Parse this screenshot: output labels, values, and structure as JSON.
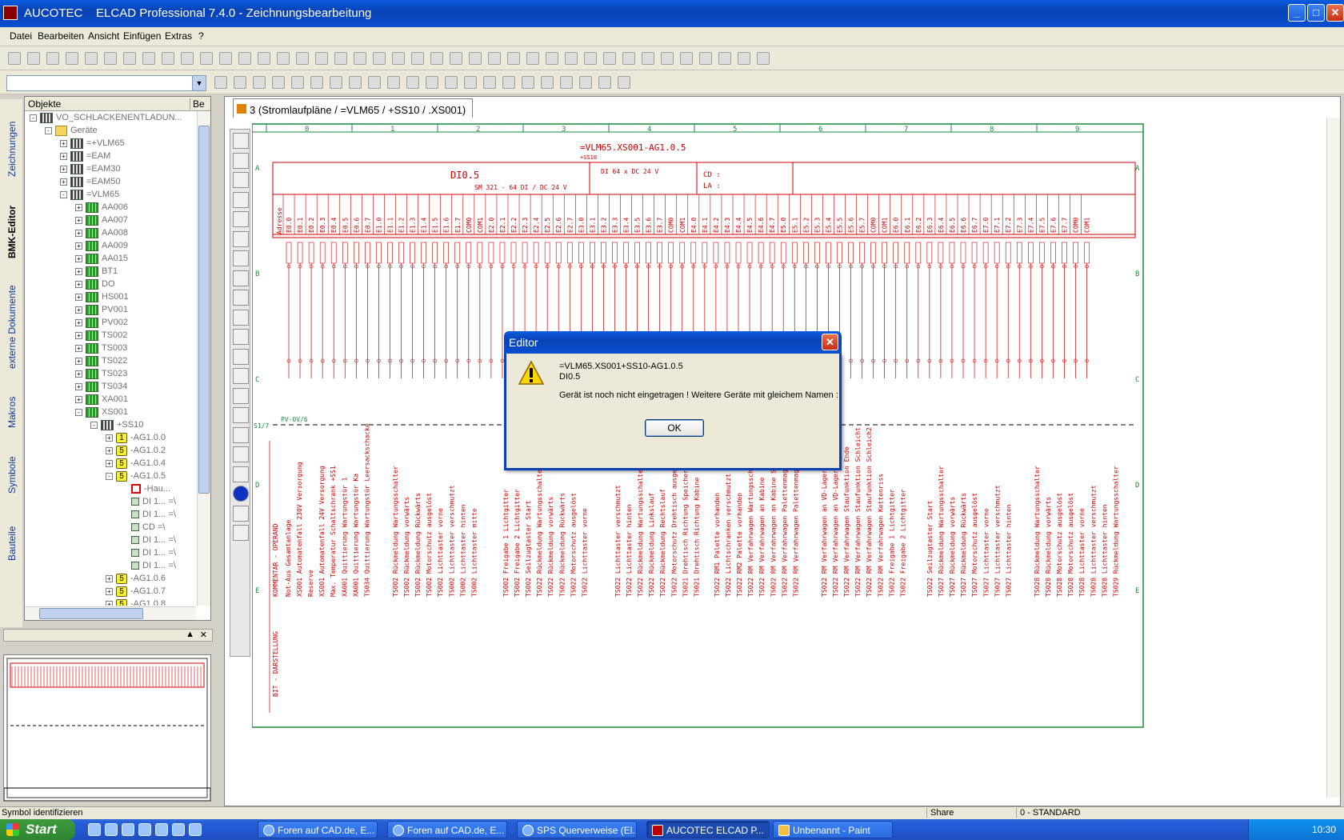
{
  "window": {
    "app": "AUCOTEC",
    "title": "ELCAD Professional 7.4.0 - Zeichnungsbearbeitung"
  },
  "menu": [
    "Datei",
    "Bearbeiten",
    "Ansicht",
    "Einfügen",
    "Extras",
    "?"
  ],
  "side_tabs": [
    "Zeichnungen",
    "BMK-Editor",
    "externe Dokumente",
    "Makros",
    "Symbole",
    "Bauteile"
  ],
  "objects": {
    "header": "Objekte",
    "header2": "Be",
    "tree": [
      {
        "label": "VO_SCHLACKENENTLADUN...",
        "indent": 0,
        "exp": "-",
        "icon": "dark"
      },
      {
        "label": "Geräte",
        "indent": 1,
        "exp": "-",
        "icon": "fold"
      },
      {
        "label": "=+VLM65",
        "indent": 2,
        "exp": "+",
        "icon": "dark"
      },
      {
        "label": "=EAM",
        "indent": 2,
        "exp": "+",
        "icon": "dark"
      },
      {
        "label": "=EAM30",
        "indent": 2,
        "exp": "+",
        "icon": "dark"
      },
      {
        "label": "=EAM50",
        "indent": 2,
        "exp": "+",
        "icon": "dark"
      },
      {
        "label": "=VLM65",
        "indent": 2,
        "exp": "-",
        "icon": "dark"
      },
      {
        "label": "AA006",
        "indent": 3,
        "exp": "+",
        "icon": "green"
      },
      {
        "label": "AA007",
        "indent": 3,
        "exp": "+",
        "icon": "green"
      },
      {
        "label": "AA008",
        "indent": 3,
        "exp": "+",
        "icon": "green"
      },
      {
        "label": "AA009",
        "indent": 3,
        "exp": "+",
        "icon": "green"
      },
      {
        "label": "AA015",
        "indent": 3,
        "exp": "+",
        "icon": "green"
      },
      {
        "label": "BT1",
        "indent": 3,
        "exp": "+",
        "icon": "green"
      },
      {
        "label": "DO",
        "indent": 3,
        "exp": "+",
        "icon": "green"
      },
      {
        "label": "HS001",
        "indent": 3,
        "exp": "+",
        "icon": "green"
      },
      {
        "label": "PV001",
        "indent": 3,
        "exp": "+",
        "icon": "green"
      },
      {
        "label": "PV002",
        "indent": 3,
        "exp": "+",
        "icon": "green"
      },
      {
        "label": "TS002",
        "indent": 3,
        "exp": "+",
        "icon": "green"
      },
      {
        "label": "TS003",
        "indent": 3,
        "exp": "+",
        "icon": "green"
      },
      {
        "label": "TS022",
        "indent": 3,
        "exp": "+",
        "icon": "green"
      },
      {
        "label": "TS023",
        "indent": 3,
        "exp": "+",
        "icon": "green"
      },
      {
        "label": "TS034",
        "indent": 3,
        "exp": "+",
        "icon": "green"
      },
      {
        "label": "XA001",
        "indent": 3,
        "exp": "+",
        "icon": "green"
      },
      {
        "label": "XS001",
        "indent": 3,
        "exp": "-",
        "icon": "green"
      },
      {
        "label": "+SS10",
        "indent": 4,
        "exp": "-",
        "icon": "dark"
      },
      {
        "label": "-AG1.0.0",
        "indent": 5,
        "exp": "+",
        "icon": "yel",
        "num": "1"
      },
      {
        "label": "-AG1.0.2",
        "indent": 5,
        "exp": "+",
        "icon": "yel",
        "num": "5"
      },
      {
        "label": "-AG1.0.4",
        "indent": 5,
        "exp": "+",
        "icon": "yel",
        "num": "5"
      },
      {
        "label": "-AG1.0.5",
        "indent": 5,
        "exp": "-",
        "icon": "yel",
        "num": "5"
      },
      {
        "label": "-Hau...",
        "indent": 6,
        "exp": "",
        "icon": "red"
      },
      {
        "label": "DI 1...  =\\",
        "indent": 6,
        "exp": "",
        "icon": "small"
      },
      {
        "label": "DI 1...  =\\",
        "indent": 6,
        "exp": "",
        "icon": "small"
      },
      {
        "label": "CD      =\\",
        "indent": 6,
        "exp": "",
        "icon": "small"
      },
      {
        "label": "DI 1...  =\\",
        "indent": 6,
        "exp": "",
        "icon": "small"
      },
      {
        "label": "DI 1...  =\\",
        "indent": 6,
        "exp": "",
        "icon": "small"
      },
      {
        "label": "DI 1...  =\\",
        "indent": 6,
        "exp": "",
        "icon": "small"
      },
      {
        "label": "-AG1.0.6",
        "indent": 5,
        "exp": "+",
        "icon": "yel",
        "num": "5"
      },
      {
        "label": "-AG1.0.7",
        "indent": 5,
        "exp": "+",
        "icon": "yel",
        "num": "5"
      },
      {
        "label": "-AG1.0.8",
        "indent": 5,
        "exp": "+",
        "icon": "yel",
        "num": "5"
      }
    ]
  },
  "document_tab": "3 (Stromlaufpläne / =VLM65 / +SS10 / .XS001)",
  "sheet": {
    "columns": [
      "0",
      "1",
      "2",
      "3",
      "4",
      "5",
      "6",
      "7",
      "8",
      "9"
    ],
    "rows": [
      "A",
      "B",
      "C",
      "D",
      "E"
    ],
    "header": "=VLM65.XS001-AG1.0.5",
    "subheader": "+SS10",
    "module1": "DI0.5",
    "module1_desc": "SM 321 - 64 DI / DC 24 V",
    "module2": "DI 64 x DC 24 V",
    "cd": "CD :",
    "la": "LA :",
    "adresse": "Adresse",
    "pv_label": "PV-0V/6",
    "s_label": "S1/7",
    "kommentar": "KOMMENTAR - OPERAND",
    "bit": "BIT - DARSTELLUNG",
    "addresses": [
      "E0.0",
      "E0.1",
      "E0.2",
      "E0.3",
      "E0.4",
      "E0.5",
      "E0.6",
      "E0.7",
      "E1.0",
      "E1.1",
      "E1.2",
      "E1.3",
      "E1.4",
      "E1.5",
      "E1.6",
      "E1.7",
      "COM0",
      "COM1",
      "E2.0",
      "E2.1",
      "E2.2",
      "E2.3",
      "E2.4",
      "E2.5",
      "E2.6",
      "E2.7",
      "E3.0",
      "E3.1",
      "E3.2",
      "E3.3",
      "E3.4",
      "E3.5",
      "E3.6",
      "E3.7",
      "COM0",
      "COM1",
      "E4.0",
      "E4.1",
      "E4.2",
      "E4.3",
      "E4.4",
      "E4.5",
      "E4.6",
      "E4.7",
      "E5.0",
      "E5.1",
      "E5.2",
      "E5.3",
      "E5.4",
      "E5.5",
      "E5.6",
      "E5.7",
      "COM0",
      "COM1",
      "E6.0",
      "E6.1",
      "E6.2",
      "E6.3",
      "E6.4",
      "E6.5",
      "E6.6",
      "E6.7",
      "E7.0",
      "E7.1",
      "E7.2",
      "E7.3",
      "E7.4",
      "E7.5",
      "E7.6",
      "E7.7",
      "COM0",
      "COM1"
    ],
    "comments_a": [
      "Not-Aus Gesamtanlage",
      "XS001 Automatenfall 230V Versorgung",
      "Reserve",
      "XS001 Automatenfall 24V Versorgung",
      "Max. Temperatur Schaltschrank +SS1",
      "XA001 Quittierung Wartungstür 1",
      "XA001 Quittierung Wartungstür Ka",
      "TS034 Quittierung Wartungstür Leersackschacke"
    ],
    "comments_b": [
      "TS002 Rückmeldung Wartungsschalter",
      "TS002 Rückmeldung vorwärts",
      "TS002 Rückmeldung Rückwärts",
      "TS002 Motorschutz ausgelöst",
      "TS002 Lichttaster vorne",
      "TS002 Lichttaster verschmutzt",
      "TS002 Lichttaster hinten",
      "TS002 Lichttaster mitte"
    ],
    "comments_c": [
      "TS002 Freigabe 1 Lichtgitter",
      "TS002 Freigabe 2 Lichtgitter",
      "TS002 Seilzugtaster Start",
      "TS022 Rückmeldung Wartungsschalter",
      "TS022 Rückmeldung vorwärts",
      "TS022 Rückmeldung Rückwärts",
      "TS022 Motorschutz ausgelöst",
      "TS022 Lichttaster vorne"
    ],
    "comments_d": [
      "TS022 Lichttaster verschmutzt",
      "TS022 Lichttaster hinten",
      "TS022 Rückmeldung Wartungsschalter Drel",
      "TS022 Rückmeldung Linkslauf",
      "TS022 Rückmeldung Rechtslauf",
      "TS022 Motorschutz Drehtisch ausgelöst",
      "TS021 Drehtisch Richtung Speicher",
      "TS021 Drehtisch Richtung Kabine"
    ],
    "comments_e": [
      "TS022 RM1 Palette vorhanden",
      "TS022 Lichtschranken verschmutzt",
      "TS022 RM2 Palette vorhanden",
      "TS022 RM Verfahrwagen Wartungsschalter Ver",
      "TS022 RM Verfahrwagen an Kabine",
      "TS022 RM Verfahrwagen an Kabine Schleic",
      "TS022 RM Verfahrwagen Palettenmag. Ende",
      "TS022 RM Verfahrwagen Palettenmag. Schlei"
    ],
    "comments_f": [
      "TS022 RM Verfahrwagen an VD-Lager Ende",
      "TS022 RM Verfahrwagen an VD-Lager Schleich",
      "TS022 RM Verfahrwagen Staufunktion Ende",
      "TS022 RM Verfahrwagen Staufunktion Schleicht",
      "TS022 RM Verfahrwagen Staufunktion Schleich2",
      "TS022 RM Verfahrwagen Kettenriss",
      "TS022 Freigabe 1 Lichtgitter",
      "TS022 Freigabe 2 Lichtgitter"
    ],
    "comments_g": [
      "TS022 Seilzugtaster Start",
      "TS027 Rückmeldung Wartungsschalter",
      "TS027 Rückmeldung vorwärts",
      "TS027 Rückmeldung Rückwärts",
      "TS027 Motorschutz ausgelöst",
      "TS027 Lichttaster vorne",
      "TS027 Lichttaster verschmutzt",
      "TS027 Lichttaster hinten"
    ],
    "comments_h": [
      "TS028 Rückmeldung Wartungsschalter",
      "TS028 Rückmeldung vorwärts",
      "TS028 Motorschutz ausgelöst",
      "TS028 Motorschutz ausgelöst",
      "TS028 Lichttaster vorne",
      "TS028 Lichttaster verschmutzt",
      "TS028 Lichttaster hinten",
      "TS029 Rückmeldung Wartungsschalter"
    ]
  },
  "dialog": {
    "title": "Editor",
    "line1": "=VLM65.XS001+SS10-AG1.0.5",
    "line2": "DI0.5",
    "message": "Gerät ist noch nicht eingetragen ! Weitere Geräte mit gleichem Namen :",
    "ok": "OK"
  },
  "status": {
    "left": "Symbol identifizieren",
    "share": "Share",
    "layer": "0 - STANDARD"
  },
  "taskbar": {
    "start": "Start",
    "tasks": [
      "Foren auf CAD.de, E...",
      "Foren auf CAD.de, E...",
      "SPS Querverweise (El...",
      "AUCOTEC     ELCAD P...",
      "Unbenannt - Paint"
    ],
    "clock": "10:30"
  },
  "colors": {
    "drawing": "#cc0000",
    "accent": "#0842b4"
  }
}
